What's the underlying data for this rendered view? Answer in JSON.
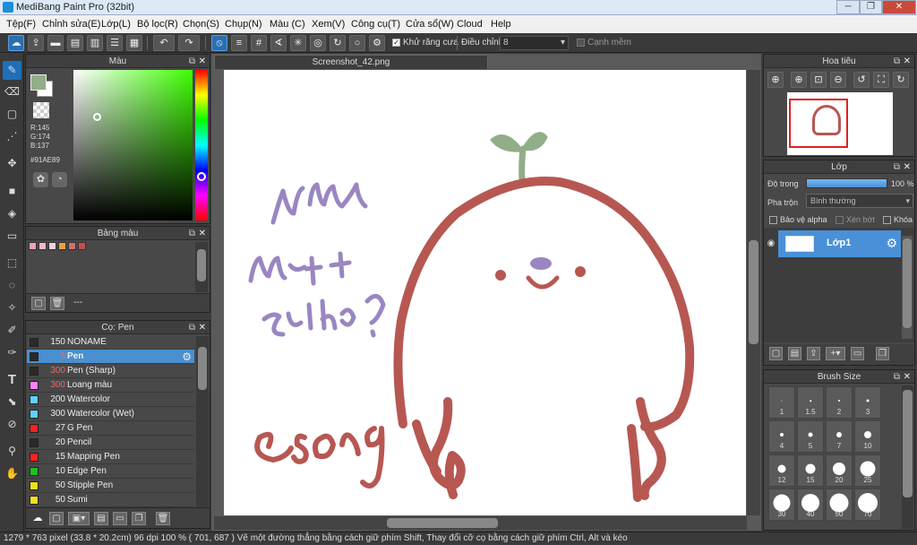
{
  "window": {
    "title": "MediBang Paint Pro (32bit)"
  },
  "menu": [
    "Tệp(F)",
    "Chỉnh sửa(E)",
    "Lớp(L)",
    "Bộ lọc(R)",
    "Chọn(S)",
    "Chụp(N)",
    "Màu (C)",
    "Xem(V)",
    "Công cụ(T)",
    "Cửa sổ(W)",
    "Cloud",
    "Help"
  ],
  "toolbar": {
    "antialias_label": "Khử răng cưa",
    "adjust_label": "Điều chỉnh",
    "adjust_value": "8",
    "soften_label": "Cạnh mềm"
  },
  "color_panel": {
    "title": "Màu",
    "r": "R:145",
    "g": "G:174",
    "b": "B:137",
    "hex": "#91AE89",
    "current_color": "#91ae89"
  },
  "palette_panel": {
    "title": "Bảng màu",
    "swatches": [
      "#f0a0c0",
      "#f4b8c8",
      "#f8d0d8",
      "#e8a040",
      "#d07070",
      "#c05050"
    ],
    "row_label": "---"
  },
  "brush_panel": {
    "title": "Cọ: Pen",
    "brushes": [
      {
        "size": "150",
        "name": "NONAME",
        "color": "#2a2a2a"
      },
      {
        "size": "5",
        "name": "Pen",
        "color": "#2a2a2a"
      },
      {
        "size": "300",
        "name": "Pen (Sharp)",
        "color": "#2a2a2a"
      },
      {
        "size": "300",
        "name": "Loang màu",
        "color": "#ff80ff"
      },
      {
        "size": "200",
        "name": "Watercolor",
        "color": "#60d0ff"
      },
      {
        "size": "300",
        "name": "Watercolor (Wet)",
        "color": "#60d0ff"
      },
      {
        "size": "27",
        "name": "G Pen",
        "color": "#ff2020"
      },
      {
        "size": "20",
        "name": "Pencil",
        "color": "#2a2a2a"
      },
      {
        "size": "15",
        "name": "Mapping Pen",
        "color": "#ff2020"
      },
      {
        "size": "10",
        "name": "Edge Pen",
        "color": "#20c020"
      },
      {
        "size": "50",
        "name": "Stipple Pen",
        "color": "#f0e020"
      },
      {
        "size": "50",
        "name": "Sumi",
        "color": "#f0e020"
      }
    ]
  },
  "canvas": {
    "tab": "Screenshot_42.png",
    "drawing_text": [
      "nhìn",
      "mặt +",
      "zui ko?",
      "esong"
    ]
  },
  "navigator": {
    "title": "Hoa tiêu"
  },
  "layer_panel": {
    "title": "Lớp",
    "opacity_label": "Độ trong",
    "opacity_value": "100 %",
    "blend_label": "Pha trộn",
    "blend_value": "Bình thường",
    "protect_alpha": "Bảo vệ alpha",
    "clipping": "Xén bớt",
    "lock": "Khóa",
    "layer_name": "Lớp1"
  },
  "brush_size_panel": {
    "title": "Brush Size",
    "sizes": [
      "1",
      "1.5",
      "2",
      "3",
      "4",
      "5",
      "7",
      "10",
      "12",
      "15",
      "20",
      "25",
      "30",
      "40",
      "50",
      "70"
    ]
  },
  "status": {
    "text": "1279 * 763 pixel   (33.8 * 20.2cm)   96 dpi   100 %   ( 701, 687 )   Vẽ một đường thẳng bằng cách giữ phím Shift, Thay đổi cỡ cọ bằng cách giữ phím Ctrl, Alt và kéo"
  }
}
